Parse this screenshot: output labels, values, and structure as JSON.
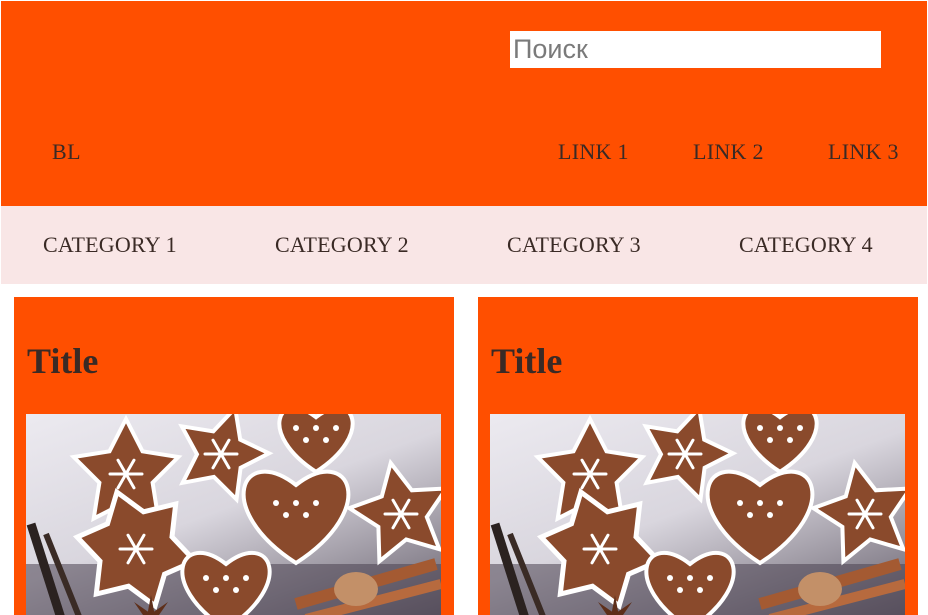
{
  "header": {
    "brand": "BL",
    "search": {
      "placeholder": "Поиск",
      "value": ""
    },
    "links": [
      "LINK 1",
      "LINK 2",
      "LINK 3"
    ]
  },
  "categories": [
    "CATEGORY 1",
    "CATEGORY 2",
    "CATEGORY 3",
    "CATEGORY 4"
  ],
  "cards": [
    {
      "title": "Title",
      "image": "gingerbread-cookies-image"
    },
    {
      "title": "Title",
      "image": "gingerbread-cookies-image"
    }
  ],
  "colors": {
    "accent": "#ff4f00",
    "category_bar": "#f9e6e6",
    "text": "#3a2a25"
  }
}
